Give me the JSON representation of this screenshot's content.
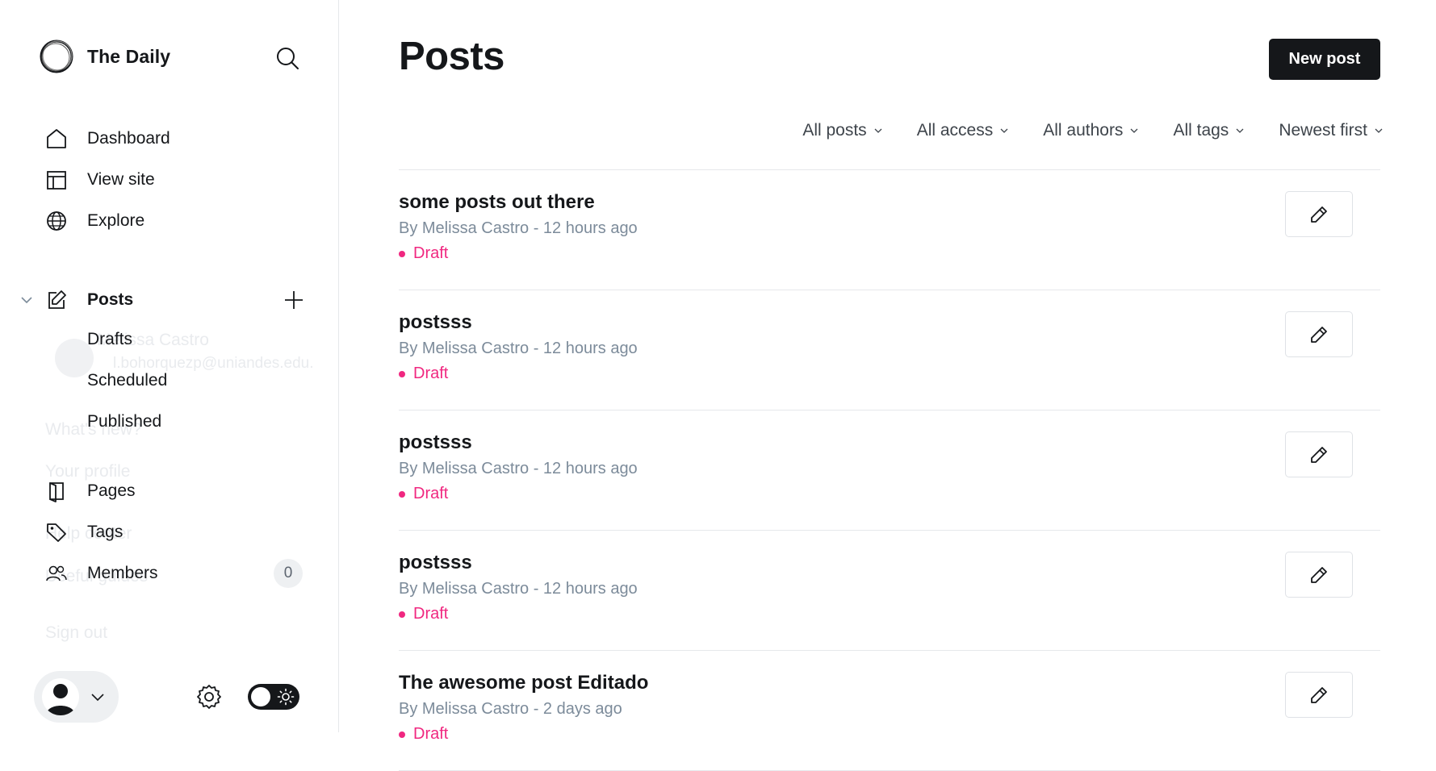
{
  "sidebar": {
    "brand": {
      "name": "The Daily"
    },
    "nav_top": [
      {
        "label": "Dashboard",
        "icon": "home-icon"
      },
      {
        "label": "View site",
        "icon": "layout-icon"
      },
      {
        "label": "Explore",
        "icon": "globe-icon"
      }
    ],
    "posts": {
      "label": "Posts",
      "icon": "edit-icon"
    },
    "posts_sub": [
      {
        "label": "Drafts"
      },
      {
        "label": "Scheduled"
      },
      {
        "label": "Published"
      }
    ],
    "nav_bottom": [
      {
        "label": "Pages",
        "icon": "page-icon"
      },
      {
        "label": "Tags",
        "icon": "tag-icon"
      },
      {
        "label": "Members",
        "icon": "members-icon",
        "badge": "0"
      }
    ],
    "ghost_menu": {
      "name": "Melissa Castro",
      "email": "l.bohorquezp@uniandes.edu.",
      "items": [
        "What's new?",
        "Your profile",
        "Help center",
        "Useful guides",
        "Sign out"
      ]
    }
  },
  "main": {
    "title": "Posts",
    "new_post_label": "New post",
    "filters": [
      {
        "label": "All posts"
      },
      {
        "label": "All access"
      },
      {
        "label": "All authors"
      },
      {
        "label": "All tags"
      },
      {
        "label": "Newest first"
      }
    ],
    "posts": [
      {
        "title": "some posts out there",
        "meta": "By Melissa Castro - 12 hours ago",
        "status": "Draft"
      },
      {
        "title": "postsss",
        "meta": "By Melissa Castro - 12 hours ago",
        "status": "Draft"
      },
      {
        "title": "postsss",
        "meta": "By Melissa Castro - 12 hours ago",
        "status": "Draft"
      },
      {
        "title": "postsss",
        "meta": "By Melissa Castro - 12 hours ago",
        "status": "Draft"
      },
      {
        "title": "The awesome post Editado",
        "meta": "By Melissa Castro - 2 days ago",
        "status": "Draft"
      }
    ]
  },
  "colors": {
    "accent_dark": "#15171a",
    "draft_pink": "#f02880",
    "meta_gray": "#7c8b9a",
    "border": "#e6e8eb"
  }
}
